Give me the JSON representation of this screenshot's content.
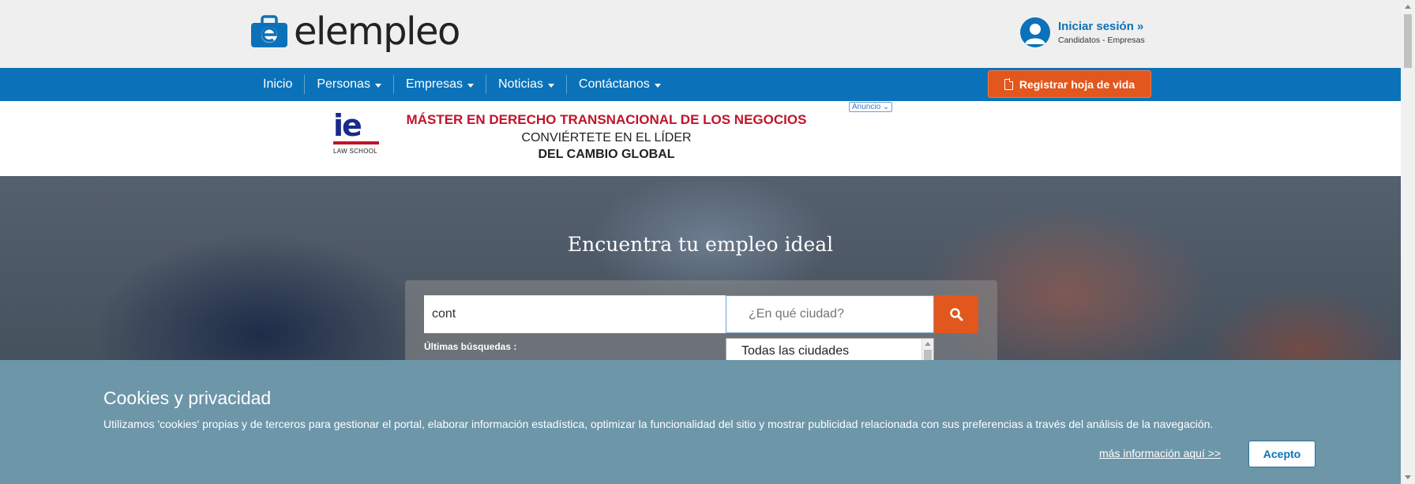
{
  "header": {
    "logo_text": "elempleo",
    "login_title": "Iniciar sesión »",
    "login_sub": "Candidatos - Empresas"
  },
  "nav": {
    "items": [
      {
        "label": "Inicio",
        "dropdown": false
      },
      {
        "label": "Personas",
        "dropdown": true
      },
      {
        "label": "Empresas",
        "dropdown": true
      },
      {
        "label": "Noticias",
        "dropdown": true
      },
      {
        "label": "Contáctanos",
        "dropdown": true
      }
    ],
    "register_label": "Registrar hoja de vida"
  },
  "ad": {
    "brand": "ie",
    "brand_sub": "LAW SCHOOL",
    "line1": "MÁSTER EN DERECHO TRANSNACIONAL DE LOS NEGOCIOS",
    "line2": "CONVIÉRTETE EN EL LÍDER",
    "line3": "DEL CAMBIO GLOBAL",
    "badge": "Anuncio"
  },
  "hero": {
    "title": "Encuentra tu empleo ideal",
    "keyword_value": "cont",
    "city_placeholder": "¿En qué ciudad?",
    "last_searches_label": "Últimas búsquedas :",
    "city_option": "Todas las ciudades"
  },
  "cookie": {
    "title": "Cookies y privacidad",
    "text": "Utilizamos 'cookies' propias y de terceros para gestionar el portal, elaborar información estadística, optimizar la funcionalidad del sitio y mostrar publicidad relacionada con sus preferencias a través del análisis de la navegación.",
    "more_link": "más información aquí >>",
    "accept_label": "Acepto"
  },
  "colors": {
    "brand_blue": "#0b72b9",
    "accent_orange": "#e2571d",
    "cookie_bg": "#6d96a9"
  },
  "icons": [
    "logo-icon",
    "avatar-icon",
    "chevron-down-icon",
    "document-icon",
    "search-icon",
    "chevron-down-small-icon"
  ]
}
